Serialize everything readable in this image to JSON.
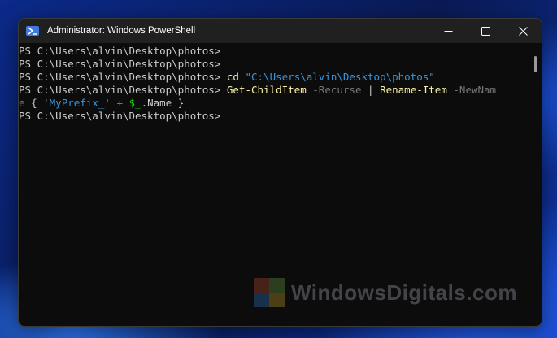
{
  "window": {
    "title": "Administrator: Windows PowerShell",
    "icon": "powershell-icon",
    "controls": [
      "minimize-icon",
      "maximize-icon",
      "close-icon"
    ]
  },
  "terminal": {
    "prompt": "PS C:\\Users\\alvin\\Desktop\\photos>",
    "cd_command": "cd",
    "cd_path": "\"C:\\Users\\alvin\\Desktop\\photos\"",
    "cmdlet1": "Get-ChildItem",
    "param1": "-Recurse",
    "pipe": "|",
    "cmdlet2": "Rename-Item",
    "param2": "-NewNam",
    "wrap_start": "e",
    "brace_open": "{",
    "prefix_string": "'MyPrefix_'",
    "plus": "+",
    "var": "$_",
    "member": ".Name",
    "brace_close": "}"
  },
  "watermark": {
    "text": "WindowsDigitals.com",
    "logo_colors": [
      "#e45a3b",
      "#7cc04b",
      "#3a8ee6",
      "#f3c42f"
    ]
  },
  "colors": {
    "terminal_bg": "#0c0c0c",
    "titlebar_bg": "#202020",
    "cmdlet": "#f9f1a5",
    "parameter": "#767676",
    "string": "#3a96dd",
    "variable": "#16c60c"
  }
}
